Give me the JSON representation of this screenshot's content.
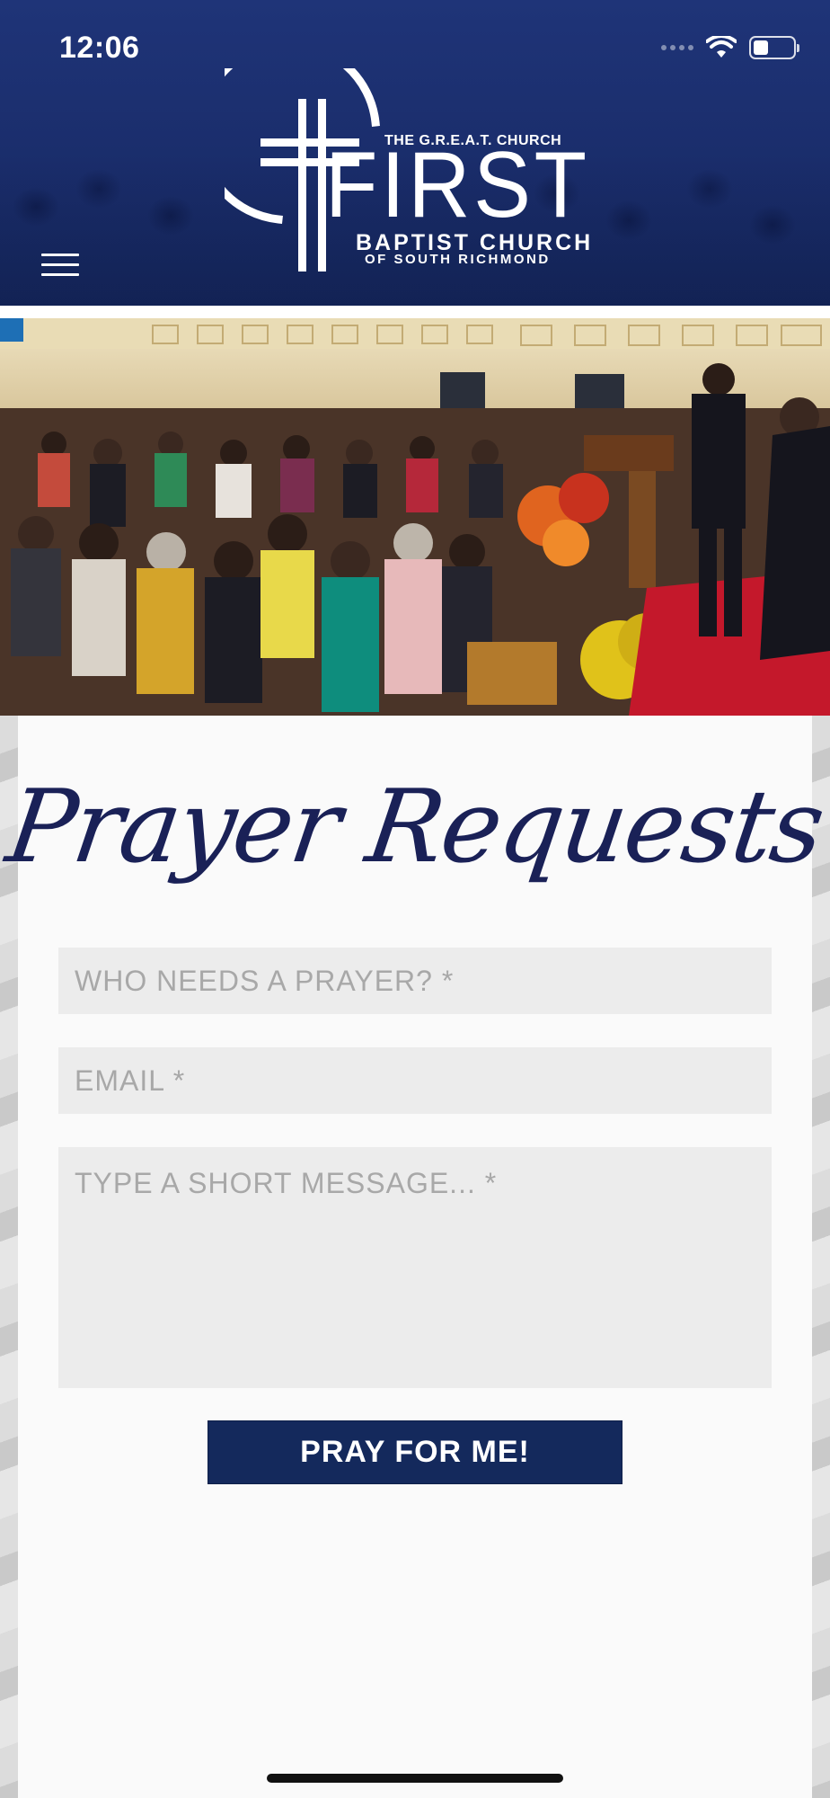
{
  "status_bar": {
    "time": "12:06"
  },
  "header": {
    "logo": {
      "tagline": "THE G.R.E.A.T. CHURCH",
      "name": "FIRST",
      "line1": "BAPTIST CHURCH",
      "line2": "OF SOUTH RICHMOND"
    },
    "menu_icon": "hamburger-menu-icon"
  },
  "form": {
    "title": "Prayer Requests",
    "name_placeholder": "WHO NEEDS A PRAYER? *",
    "email_placeholder": "EMAIL *",
    "message_placeholder": "TYPE A SHORT MESSAGE... *",
    "submit_label": "PRAY FOR ME!"
  },
  "colors": {
    "header_blue": "#1f3478",
    "button_navy": "#14295c",
    "title_navy": "#1a2157",
    "field_bg": "#ececec"
  }
}
